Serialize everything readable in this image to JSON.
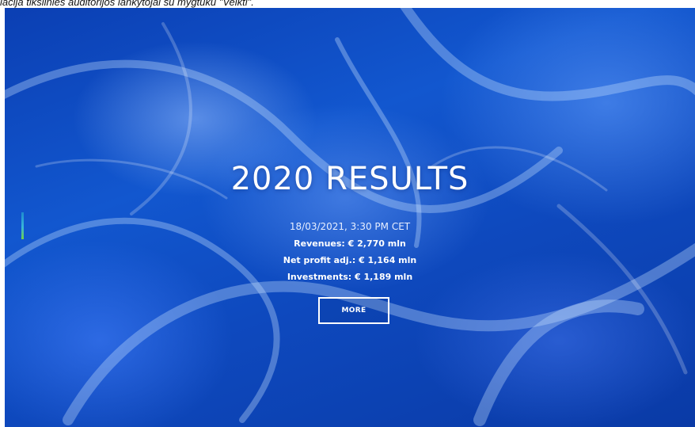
{
  "caption": {
    "text": "lacija tiksliniės auditorijos lankytojai su mygtuku \"Veikti\"."
  },
  "hero": {
    "title": "2020 RESULTS",
    "datetime": "18/03/2021, 3:30 PM CET",
    "stats": [
      "Revenues: € 2,770 mln",
      "Net profit adj.: € 1,164 mln",
      "Investments: € 1,189 mln"
    ],
    "more_label": "MORE"
  },
  "colors": {
    "background_primary": "#0f4fc4",
    "background_dark": "#0a3aa6",
    "text": "#ffffff",
    "indicator_top": "#1e8ccf",
    "indicator_bottom": "#6fd04a"
  },
  "icons": {
    "background": "abstract-blue-swirl-image"
  }
}
